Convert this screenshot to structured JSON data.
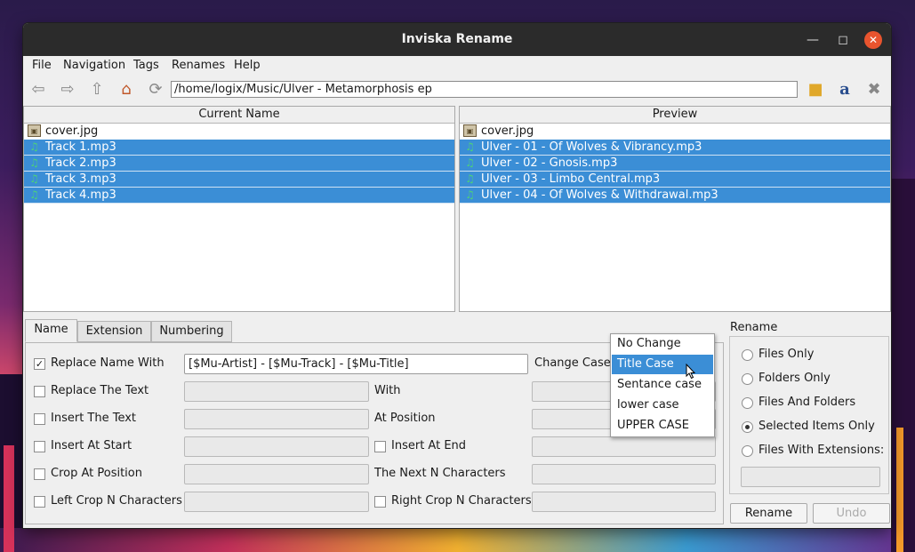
{
  "window": {
    "title": "Inviska Rename"
  },
  "menu": [
    "File",
    "Navigation",
    "Tags",
    "Renames",
    "Help"
  ],
  "toolbar": {
    "path": "/home/logix/Music/Ulver - Metamorphosis ep"
  },
  "current": {
    "header": "Current Name",
    "files": [
      {
        "name": "cover.jpg",
        "type": "image",
        "selected": false
      },
      {
        "name": "Track 1.mp3",
        "type": "audio",
        "selected": true
      },
      {
        "name": "Track 2.mp3",
        "type": "audio",
        "selected": true
      },
      {
        "name": "Track 3.mp3",
        "type": "audio",
        "selected": true
      },
      {
        "name": "Track 4.mp3",
        "type": "audio",
        "selected": true
      }
    ]
  },
  "preview": {
    "header": "Preview",
    "files": [
      {
        "name": "cover.jpg",
        "type": "image",
        "selected": false
      },
      {
        "name": "Ulver - 01 - Of Wolves & Vibrancy.mp3",
        "type": "audio",
        "selected": true
      },
      {
        "name": "Ulver - 02 - Gnosis.mp3",
        "type": "audio",
        "selected": true
      },
      {
        "name": "Ulver - 03 - Limbo Central.mp3",
        "type": "audio",
        "selected": true
      },
      {
        "name": "Ulver - 04 - Of Wolves & Withdrawal.mp3",
        "type": "audio",
        "selected": true
      }
    ]
  },
  "tabs": [
    "Name",
    "Extension",
    "Numbering"
  ],
  "name_panel": {
    "replace_name_with": {
      "label": "Replace Name With",
      "checked": true,
      "value": "[$Mu-Artist] - [$Mu-Track] - [$Mu-Title]"
    },
    "replace_text": {
      "label": "Replace The Text"
    },
    "insert_text": {
      "label": "Insert The Text"
    },
    "insert_at_start": {
      "label": "Insert At Start"
    },
    "crop_at_position": {
      "label": "Crop At Position"
    },
    "left_crop": {
      "label": "Left Crop N Characters"
    },
    "change_case": {
      "label": "Change Case"
    },
    "with": {
      "label": "With"
    },
    "at_position": {
      "label": "At Position"
    },
    "insert_at_end": {
      "label": "Insert At End"
    },
    "next_n": {
      "label": "The Next N Characters"
    },
    "right_crop": {
      "label": "Right Crop N Characters"
    }
  },
  "case_dropdown": {
    "options": [
      "No Change",
      "Title Case",
      "Sentance case",
      "lower case",
      "UPPER CASE"
    ],
    "highlighted": "Title Case"
  },
  "rename": {
    "title": "Rename",
    "options": [
      "Files Only",
      "Folders Only",
      "Files And Folders",
      "Selected Items Only",
      "Files With Extensions:"
    ],
    "selected": "Selected Items Only",
    "rename_button": "Rename",
    "undo_button": "Undo"
  },
  "colors": {
    "selection": "#3b8ed6",
    "close_button": "#e9542e",
    "titlebar": "#2b2b2b"
  }
}
